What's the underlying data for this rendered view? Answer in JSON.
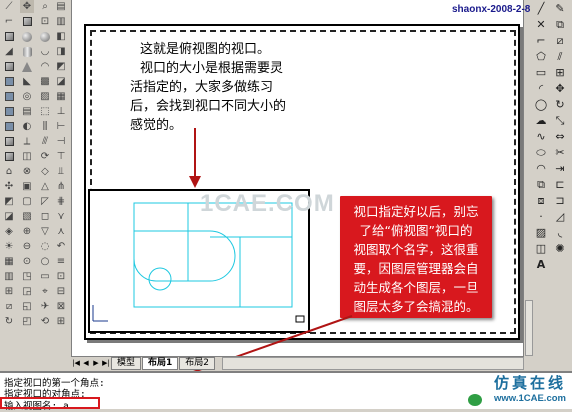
{
  "signature": "shaonx-2008-2-8",
  "watermark": "1CAE.COM",
  "annotation_top": [
    "这就是俯视图的视口。",
    "视口的大小是根据需要灵",
    "活指定的，大家多做练习",
    "后，会找到视口不同大小的",
    "感觉的。"
  ],
  "annotation_red": [
    "视口指定好以后，别忘",
    "了给“俯视图”视口的",
    "视图取个名字，这很重",
    "要，因图层管理器会自",
    "动生成各个图层，一旦",
    "图层太多了会搞混的。"
  ],
  "tabs": {
    "model": "模型",
    "layout1": "布局1",
    "layout2": "布局2"
  },
  "command_lines": [
    "指定视口的第一个角点:",
    "指定视口的对角点:",
    "输入视图名: a"
  ],
  "logo": {
    "name": "仿真在线",
    "url": "www.1CAE.com"
  },
  "colors": {
    "accent_red": "#d8181e",
    "drawing_cyan": "#1ec8e0",
    "logo_blue": "#1d6f9e"
  },
  "icons": {
    "left_toolbar": [
      "line-icon",
      "cube-icon",
      "sphere-icon",
      "cylinder-icon",
      "cone-icon",
      "box-icon",
      "wedge-icon",
      "torus-icon",
      "union-icon",
      "subtract-icon",
      "intersect-icon",
      "extrude-icon",
      "revolve-icon",
      "section-icon"
    ],
    "right_toolbar": [
      "line-icon",
      "xline-icon",
      "polyline-icon",
      "polygon-icon",
      "rectangle-icon",
      "arc-icon",
      "circle-icon",
      "revcloud-icon",
      "spline-icon",
      "ellipse-icon",
      "insert-icon",
      "block-icon",
      "point-icon",
      "hatch-icon",
      "region-icon",
      "text-icon"
    ]
  }
}
